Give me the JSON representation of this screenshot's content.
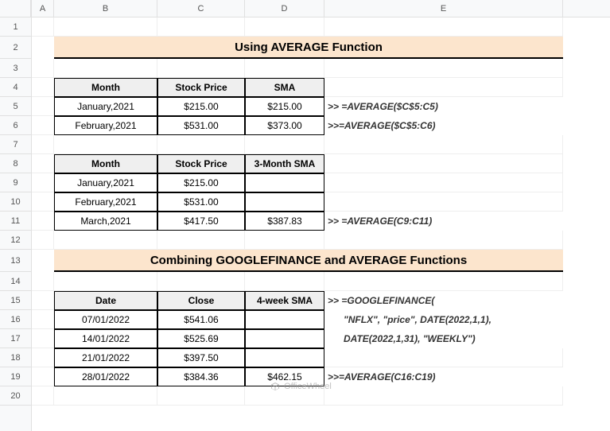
{
  "columns": [
    "A",
    "B",
    "C",
    "D",
    "E"
  ],
  "rows": [
    "1",
    "2",
    "3",
    "4",
    "5",
    "6",
    "7",
    "8",
    "9",
    "10",
    "11",
    "12",
    "13",
    "14",
    "15",
    "16",
    "17",
    "18",
    "19",
    "20"
  ],
  "title1": "Using AVERAGE Function",
  "table1": {
    "headers": {
      "b": "Month",
      "c": "Stock Price",
      "d": "SMA"
    },
    "r1": {
      "b": "January,2021",
      "c": "$215.00",
      "d": "$215.00",
      "e": ">> =AVERAGE($C$5:C5)"
    },
    "r2": {
      "b": "February,2021",
      "c": "$531.00",
      "d": "$373.00",
      "e": ">>=AVERAGE($C$5:C6)"
    }
  },
  "table2": {
    "headers": {
      "b": "Month",
      "c": "Stock Price",
      "d": "3-Month SMA"
    },
    "r1": {
      "b": "January,2021",
      "c": "$215.00",
      "d": ""
    },
    "r2": {
      "b": "February,2021",
      "c": "$531.00",
      "d": ""
    },
    "r3": {
      "b": "March,2021",
      "c": "$417.50",
      "d": "$387.83",
      "e": ">> =AVERAGE(C9:C11)"
    }
  },
  "title2": "Combining GOOGLEFINANCE and AVERAGE Functions",
  "table3": {
    "headers": {
      "b": "Date",
      "c": "Close",
      "d": "4-week SMA"
    },
    "r1": {
      "b": "07/01/2022",
      "c": "$541.06",
      "d": "",
      "e": ">> =GOOGLEFINANCE("
    },
    "r2": {
      "b": "14/01/2022",
      "c": "$525.69",
      "d": "",
      "e": "      \"NFLX\", \"price\", DATE(2022,1,1),"
    },
    "r3": {
      "b": "21/01/2022",
      "c": "$397.50",
      "d": "",
      "e": "      DATE(2022,1,31), \"WEEKLY\")"
    },
    "r4": {
      "b": "28/01/2022",
      "c": "$384.36",
      "d": "$462.15",
      "e": ">>=AVERAGE(C16:C19)"
    }
  },
  "watermark": "OfficeWheel"
}
